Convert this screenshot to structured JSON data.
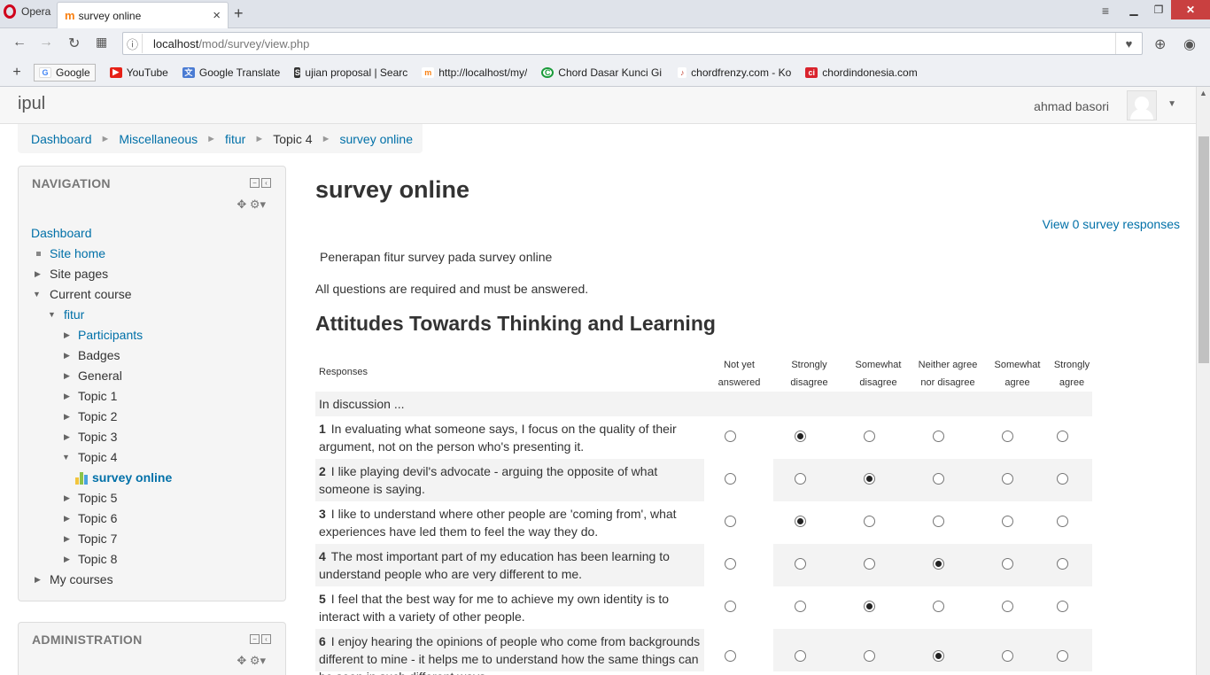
{
  "browser": {
    "menu_label": "Opera",
    "tab_title": "survey online",
    "tab_close": "×",
    "new_tab": "+",
    "url_host": "localhost",
    "url_path": "/mod/survey/view.php",
    "bookmark_add": "+",
    "bookmarks": [
      {
        "label": "Google",
        "color": "#4285f4",
        "glyph": "G"
      },
      {
        "label": "YouTube",
        "color": "#e62117",
        "glyph": "▶"
      },
      {
        "label": "Google Translate",
        "color": "#4a7bd3",
        "glyph": "文"
      },
      {
        "label": "ujian proposal | Searc",
        "color": "#333333",
        "glyph": "S"
      },
      {
        "label": "http://localhost/my/",
        "color": "#f98012",
        "glyph": "m"
      },
      {
        "label": "Chord Dasar Kunci Gi",
        "color": "#1a9b3a",
        "glyph": "C"
      },
      {
        "label": "chordfrenzy.com - Ko",
        "color": "#c0392b",
        "glyph": "♪"
      },
      {
        "label": "chordindonesia.com",
        "color": "#d9232d",
        "glyph": "ci"
      }
    ]
  },
  "site": {
    "brand": "ipul",
    "user_name": "ahmad basori"
  },
  "breadcrumb": {
    "items": [
      "Dashboard",
      "Miscellaneous",
      "fitur",
      "Topic 4",
      "survey online"
    ],
    "separator": "►"
  },
  "navigation": {
    "title": "NAVIGATION",
    "dashboard": "Dashboard",
    "site_home": "Site home",
    "site_pages": "Site pages",
    "current_course": "Current course",
    "course": "fitur",
    "participants": "Participants",
    "badges": "Badges",
    "general": "General",
    "topics": [
      "Topic 1",
      "Topic 2",
      "Topic 3",
      "Topic 4",
      "Topic 5",
      "Topic 6",
      "Topic 7",
      "Topic 8"
    ],
    "active_activity": "survey online",
    "my_courses": "My courses"
  },
  "administration": {
    "title": "ADMINISTRATION"
  },
  "main": {
    "title": "survey online",
    "view_responses": "View 0 survey responses",
    "intro": "Penerapan fitur survey pada survey online",
    "required_note": "All questions are required and must be answered.",
    "section_title": "Attitudes Towards Thinking and Learning"
  },
  "survey": {
    "responses_header": "Responses",
    "columns": [
      [
        "Not yet",
        "answered"
      ],
      [
        "Strongly",
        "disagree"
      ],
      [
        "Somewhat",
        "disagree"
      ],
      [
        "Neither agree",
        "nor disagree"
      ],
      [
        "Somewhat",
        "agree"
      ],
      [
        "Strongly",
        "agree"
      ]
    ],
    "group_label": "In discussion ...",
    "questions": [
      {
        "num": "1",
        "text": "In evaluating what someone says, I focus on the quality of their argument, not on the person who's presenting it.",
        "selected": 1
      },
      {
        "num": "2",
        "text": "I like playing devil's advocate - arguing the opposite of what someone is saying.",
        "selected": 2
      },
      {
        "num": "3",
        "text": "I like to understand where other people are 'coming from', what experiences have led them to feel the way they do.",
        "selected": 1
      },
      {
        "num": "4",
        "text": "The most important part of my education has been learning to understand people who are very different to me.",
        "selected": 3
      },
      {
        "num": "5",
        "text": "I feel that the best way for me to achieve my own identity is to interact with a variety of other people.",
        "selected": 2
      },
      {
        "num": "6",
        "text": "I enjoy hearing the opinions of people who come from backgrounds different to mine - it helps me to understand how the same things can be seen in such different ways.",
        "selected": 3
      }
    ]
  }
}
